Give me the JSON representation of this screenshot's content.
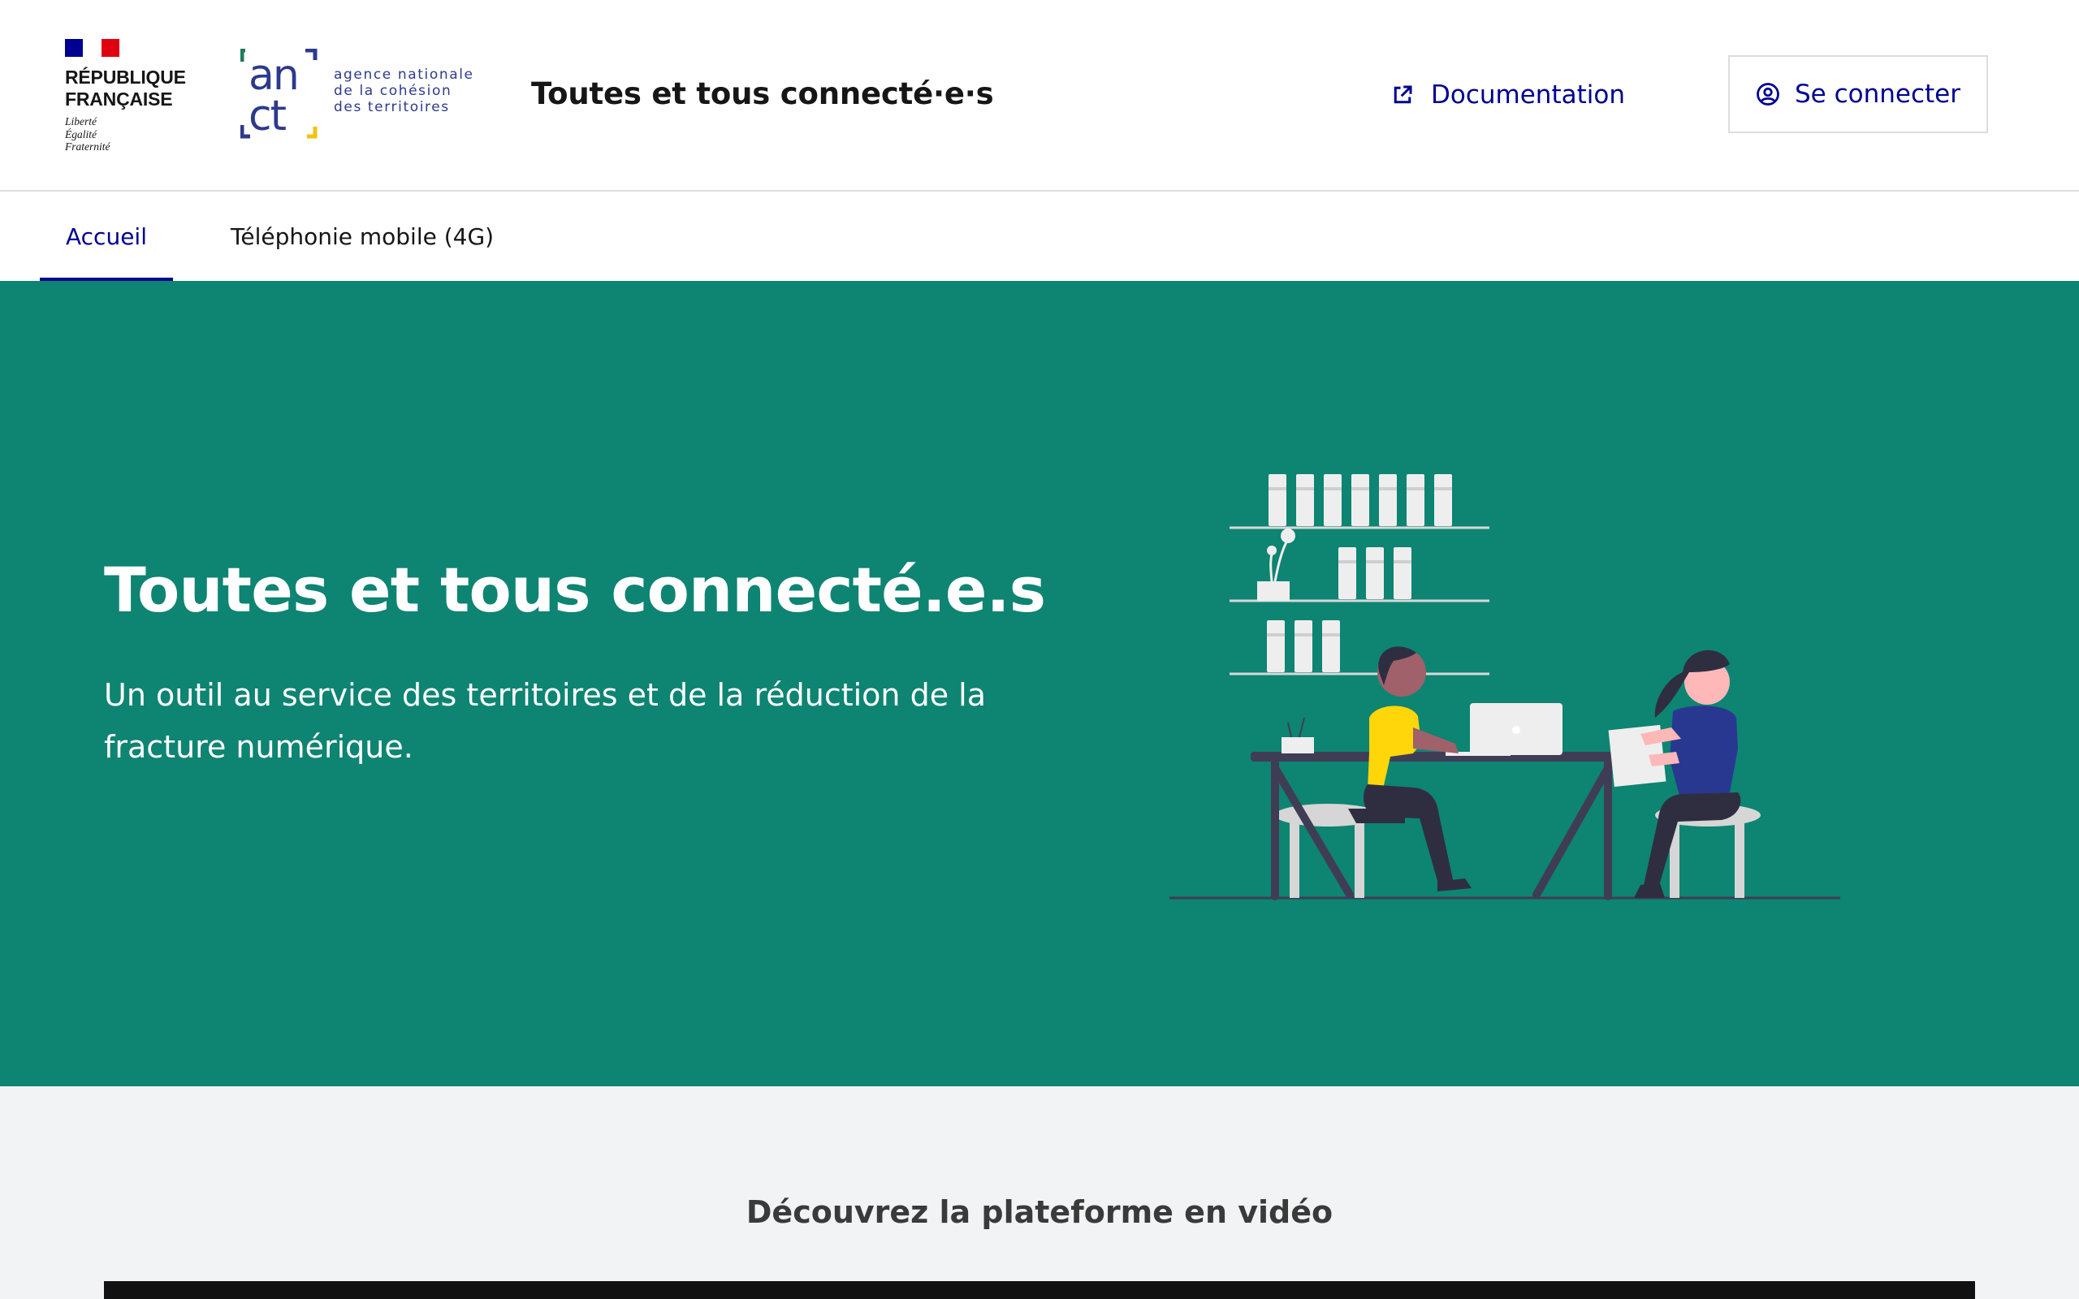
{
  "header": {
    "republique": {
      "name": "RÉPUBLIQUE\nFRANÇAISE",
      "motto": "Liberté\nÉgalité\nFraternité",
      "flag_colors": [
        "#000091",
        "#ffffff",
        "#e1000f"
      ]
    },
    "anct": {
      "mark_text": "anct",
      "text": "agence nationale\nde la cohésion\ndes territoires",
      "brand_color": "#2d3a8c"
    },
    "site_title": "Toutes et tous connecté·e·s",
    "documentation_label": "Documentation",
    "documentation_icon": "external-link-icon",
    "login_label": "Se connecter",
    "login_icon": "user-circle-icon"
  },
  "nav": {
    "items": [
      {
        "label": "Accueil",
        "active": true
      },
      {
        "label": "Téléphonie mobile (4G)",
        "active": false
      }
    ]
  },
  "hero": {
    "title": "Toutes et tous connecté.e.s",
    "subtitle": "Un outil au service des territoires et de la réduction de la fracture numérique.",
    "background_color": "#0e8472",
    "illustration": "two-people-working-at-desk-illustration"
  },
  "video_section": {
    "title": "Découvrez la plateforme en vidéo"
  },
  "colors": {
    "primary": "#000091",
    "hero_green": "#0e8472",
    "section_bg": "#f2f3f5"
  }
}
